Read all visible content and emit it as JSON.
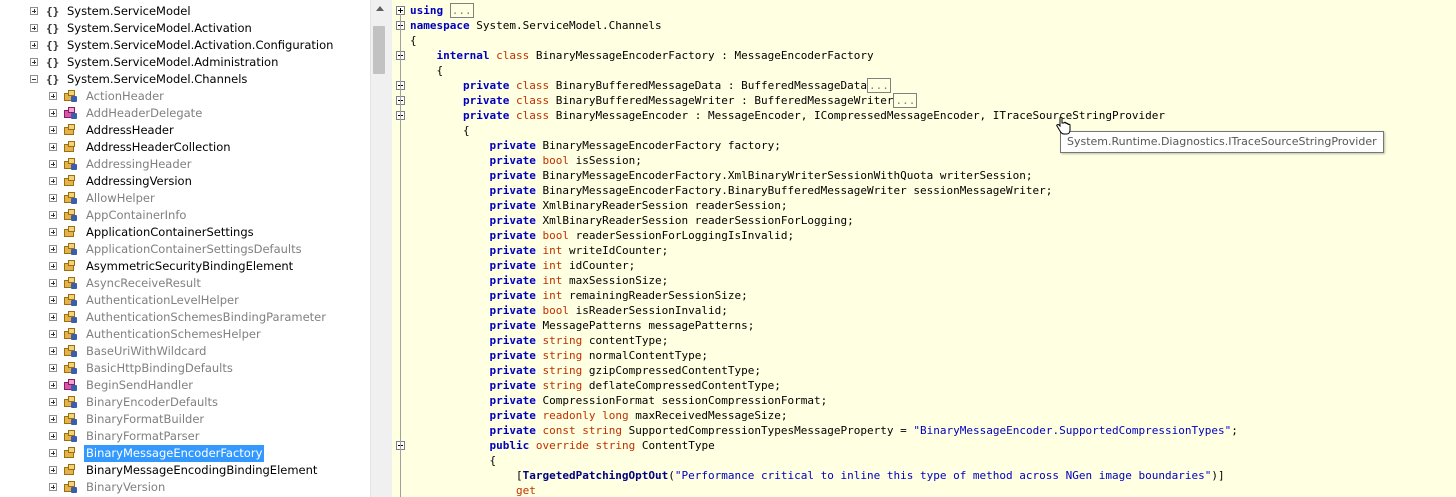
{
  "tree": {
    "namespaces": [
      {
        "label": "System.ServiceModel",
        "expanded": false
      },
      {
        "label": "System.ServiceModel.Activation",
        "expanded": false
      },
      {
        "label": "System.ServiceModel.Activation.Configuration",
        "expanded": false
      },
      {
        "label": "System.ServiceModel.Administration",
        "expanded": false
      },
      {
        "label": "System.ServiceModel.Channels",
        "expanded": true
      }
    ],
    "classes": [
      {
        "label": "ActionHeader",
        "style": "dim",
        "icon": "class-icon"
      },
      {
        "label": "AddHeaderDelegate",
        "style": "dim",
        "icon": "delegate-icon"
      },
      {
        "label": "AddressHeader",
        "style": "normal",
        "icon": "class-icon"
      },
      {
        "label": "AddressHeaderCollection",
        "style": "normal",
        "icon": "class-icon"
      },
      {
        "label": "AddressingHeader",
        "style": "dim",
        "icon": "class-icon"
      },
      {
        "label": "AddressingVersion",
        "style": "normal",
        "icon": "class-icon"
      },
      {
        "label": "AllowHelper",
        "style": "dim",
        "icon": "class-icon"
      },
      {
        "label": "AppContainerInfo",
        "style": "dim",
        "icon": "class-icon"
      },
      {
        "label": "ApplicationContainerSettings",
        "style": "normal",
        "icon": "class-icon"
      },
      {
        "label": "ApplicationContainerSettingsDefaults",
        "style": "dim",
        "icon": "class-icon"
      },
      {
        "label": "AsymmetricSecurityBindingElement",
        "style": "normal",
        "icon": "class-icon"
      },
      {
        "label": "AsyncReceiveResult",
        "style": "dim",
        "icon": "class-icon"
      },
      {
        "label": "AuthenticationLevelHelper",
        "style": "dim",
        "icon": "class-icon"
      },
      {
        "label": "AuthenticationSchemesBindingParameter",
        "style": "dim",
        "icon": "class-icon"
      },
      {
        "label": "AuthenticationSchemesHelper",
        "style": "dim",
        "icon": "class-icon"
      },
      {
        "label": "BaseUriWithWildcard",
        "style": "dim",
        "icon": "class-icon"
      },
      {
        "label": "BasicHttpBindingDefaults",
        "style": "dim",
        "icon": "class-icon"
      },
      {
        "label": "BeginSendHandler",
        "style": "dim",
        "icon": "delegate-icon"
      },
      {
        "label": "BinaryEncoderDefaults",
        "style": "dim",
        "icon": "class-icon"
      },
      {
        "label": "BinaryFormatBuilder",
        "style": "dim",
        "icon": "class-icon"
      },
      {
        "label": "BinaryFormatParser",
        "style": "dim",
        "icon": "class-icon"
      },
      {
        "label": "BinaryMessageEncoderFactory",
        "style": "selected",
        "icon": "class-icon"
      },
      {
        "label": "BinaryMessageEncodingBindingElement",
        "style": "normal",
        "icon": "class-icon"
      },
      {
        "label": "BinaryVersion",
        "style": "dim",
        "icon": "class-icon"
      }
    ]
  },
  "code": {
    "lines": [
      "using ...",
      "namespace System.ServiceModel.Channels",
      "{",
      "    internal class BinaryMessageEncoderFactory : MessageEncoderFactory",
      "    {",
      "        private class BinaryBufferedMessageData : BufferedMessageData...",
      "        private class BinaryBufferedMessageWriter : BufferedMessageWriter...",
      "        private class BinaryMessageEncoder : MessageEncoder, ICompressedMessageEncoder, ITraceSourceStringProvider",
      "        {",
      "            private BinaryMessageEncoderFactory factory;",
      "            private bool isSession;",
      "            private BinaryMessageEncoderFactory.XmlBinaryWriterSessionWithQuota writerSession;",
      "            private BinaryMessageEncoderFactory.BinaryBufferedMessageWriter sessionMessageWriter;",
      "            private XmlBinaryReaderSession readerSession;",
      "            private XmlBinaryReaderSession readerSessionForLogging;",
      "            private bool readerSessionForLoggingIsInvalid;",
      "            private int writeIdCounter;",
      "            private int idCounter;",
      "            private int maxSessionSize;",
      "            private int remainingReaderSessionSize;",
      "            private bool isReaderSessionInvalid;",
      "            private MessagePatterns messagePatterns;",
      "            private string contentType;",
      "            private string normalContentType;",
      "            private string gzipCompressedContentType;",
      "            private string deflateCompressedContentType;",
      "            private CompressionFormat sessionCompressionFormat;",
      "            private readonly long maxReceivedMessageSize;",
      "            private const string SupportedCompressionTypesMessageProperty = \"BinaryMessageEncoder.SupportedCompressionTypes\";",
      "            public override string ContentType",
      "            {",
      "                [TargetedPatchingOptOut(\"Performance critical to inline this type of method across NGen image boundaries\")]",
      "                get"
    ]
  },
  "tooltip": {
    "text": "System.Runtime.Diagnostics.ITraceSourceStringProvider"
  }
}
